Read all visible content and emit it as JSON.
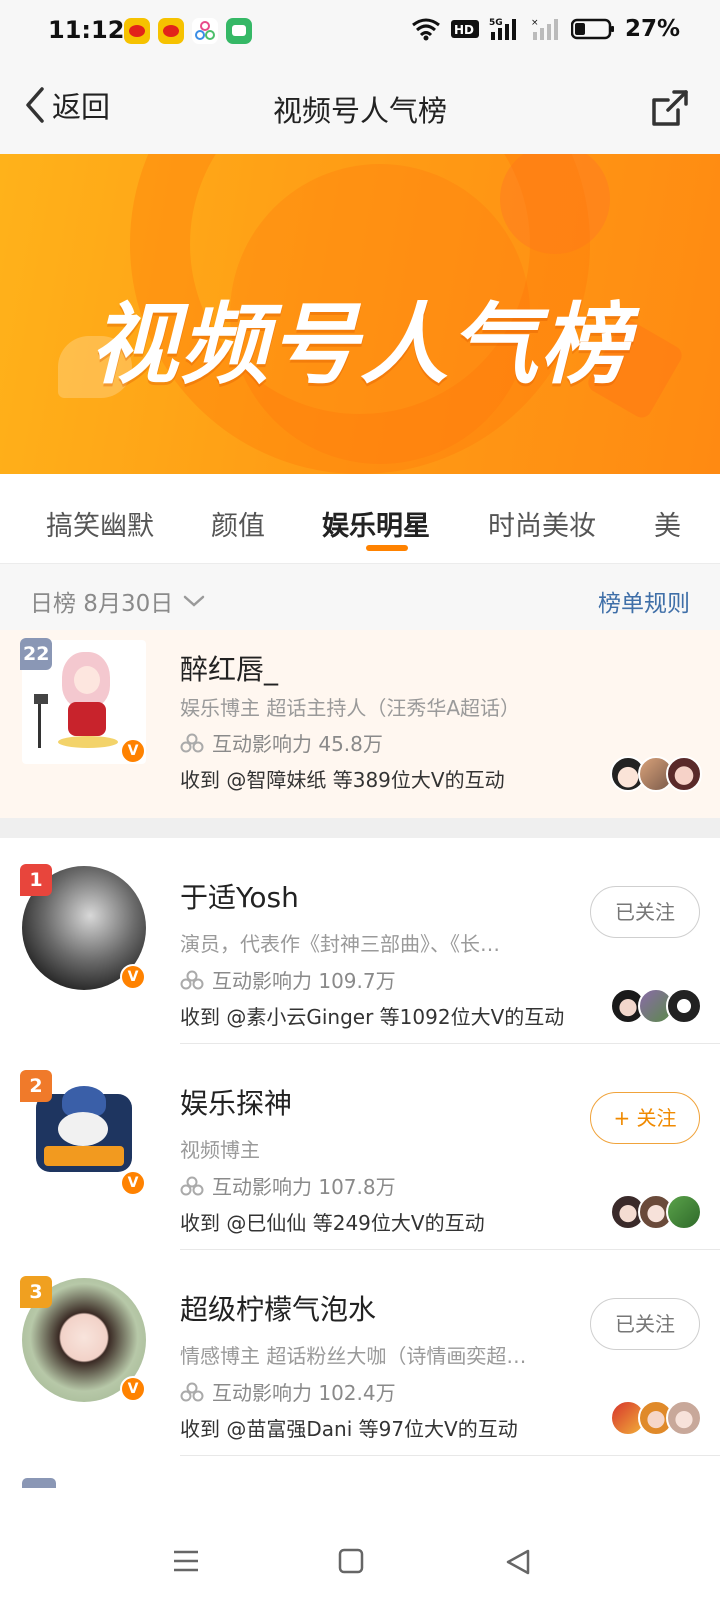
{
  "status_bar": {
    "time": "11:12",
    "battery": "27%",
    "icons": [
      "weibo-icon",
      "weibo-icon",
      "color-app-icon",
      "chat-app-icon",
      "wifi-icon",
      "hd-icon",
      "signal-5g-icon",
      "signal-icon",
      "battery-icon"
    ]
  },
  "nav": {
    "back_label": "返回",
    "title": "视频号人气榜",
    "share_icon": "share-icon"
  },
  "banner": {
    "title": "视频号人气榜"
  },
  "tabs": [
    {
      "label": "搞笑幽默",
      "active": false
    },
    {
      "label": "颜值",
      "active": false
    },
    {
      "label": "娱乐明星",
      "active": true
    },
    {
      "label": "时尚美妆",
      "active": false
    },
    {
      "label": "美",
      "active": false
    }
  ],
  "date_row": {
    "label": "日榜 8月30日",
    "rules_link": "榜单规则"
  },
  "my_entry": {
    "rank": "22",
    "name": "醉红唇_",
    "desc": "娱乐博主 超话主持人（汪秀华A超话）",
    "influence": "互动影响力 45.8万",
    "received": "收到 @智障妹纸 等389位大V的互动"
  },
  "ranking": [
    {
      "rank": "1",
      "name": "于适Yosh",
      "desc": "演员，代表作《封神三部曲》、《长…",
      "influence": "互动影响力 109.7万",
      "received": "收到 @素小云Ginger 等1092位大V的互动",
      "follow_label": "已关注",
      "followed": true
    },
    {
      "rank": "2",
      "name": "娱乐探神",
      "desc": "视频博主",
      "influence": "互动影响力 107.8万",
      "received": "收到 @巳仙仙 等249位大V的互动",
      "follow_label": "+ 关注",
      "followed": false
    },
    {
      "rank": "3",
      "name": "超级柠檬气泡水",
      "desc": "情感博主 超话粉丝大咖（诗情画奕超…",
      "influence": "互动影响力 102.4万",
      "received": "收到 @苗富强Dani 等97位大V的互动",
      "follow_label": "已关注",
      "followed": true
    }
  ],
  "colors": {
    "accent": "#ff8200",
    "rank1": "#e8453c",
    "rank2": "#f07a2a",
    "rank3": "#f0a020",
    "rank_other": "#8a97b5",
    "link": "#3f6fa8"
  }
}
